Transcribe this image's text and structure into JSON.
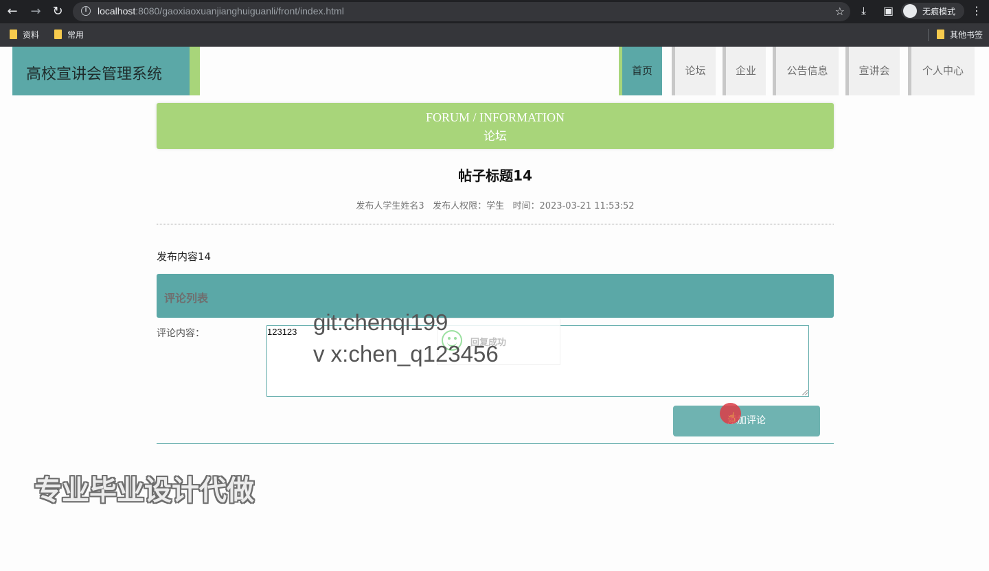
{
  "browser": {
    "url_host": "localhost",
    "url_rest": ":8080/gaoxiaoxuanjianghuiguanli/front/index.html",
    "incognito_label": "无痕模式",
    "bookmarks": [
      "资料",
      "常用"
    ],
    "other_bookmarks": "其他书签"
  },
  "site": {
    "title": "高校宣讲会管理系统",
    "nav": [
      {
        "label": "首页",
        "active": true
      },
      {
        "label": "论坛",
        "active": false
      },
      {
        "label": "企业",
        "active": false
      },
      {
        "label": "公告信息",
        "active": false
      },
      {
        "label": "宣讲会",
        "active": false
      },
      {
        "label": "个人中心",
        "active": false
      }
    ]
  },
  "banner": {
    "en": "FORUM / INFORMATION",
    "cn": "论坛"
  },
  "post": {
    "title": "帖子标题14",
    "meta": "发布人学生姓名3   发布人权限：学生   时间：2023-03-21 11:53:52",
    "content": "发布内容14"
  },
  "comments": {
    "header": "评论列表",
    "field_label": "评论内容：",
    "field_value": "123123",
    "submit_label": "添加评论"
  },
  "toast": {
    "message": "回复成功"
  },
  "overlay": {
    "line1": "git:chenqi199",
    "line2": "v x:chen_q123456",
    "ad": "专业毕业设计代做"
  },
  "colors": {
    "primary": "#5ba8a7",
    "accent": "#a8d57a",
    "chrome": "#202124"
  }
}
